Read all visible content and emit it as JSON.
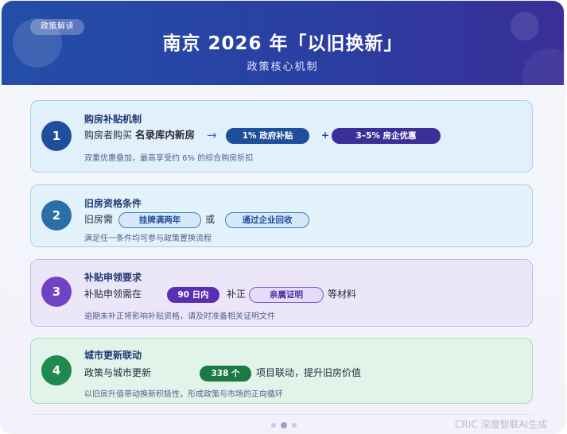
{
  "header": {
    "tag": "政策解读",
    "title": "南京 2026 年「以旧换新」",
    "subtitle": "政策核心机制"
  },
  "steps": [
    {
      "number": "1",
      "title": "购房补贴机制",
      "text1": "购房者购买",
      "text2": "名录库内新房",
      "arrow": "→",
      "pill1": "1% 政府补贴",
      "plus": "+",
      "pill2": "3–5% 房企优惠",
      "note": "双重优惠叠加，最高享受约 6% 的综合购房折扣"
    },
    {
      "number": "2",
      "title": "旧房资格条件",
      "text1": "旧房需",
      "pill1": "挂牌满两年",
      "text2": "或",
      "pill2": "通过企业回收",
      "note": "满足任一条件均可参与政策置换流程"
    },
    {
      "number": "3",
      "title": "补贴申领要求",
      "text1": "补贴申领需在",
      "pill1": "90 日内",
      "text2": "补正",
      "pill2": "亲属证明",
      "text3": "等材料",
      "note": "逾期未补正将影响补贴资格，请及时准备相关证明文件"
    },
    {
      "number": "4",
      "title": "城市更新联动",
      "text1": "政策与城市更新",
      "pill1": "338 个",
      "text2": "项目联动，提升旧房价值",
      "note": "以旧房升值带动换新积极性，形成政策与市场的正向循环"
    }
  ],
  "footer": {
    "watermark": "CRIC 深度智联AI生成"
  },
  "colors": {
    "header_start": "#234ea8",
    "header_end": "#3a2f98",
    "step1_accent": "#1f4f9a",
    "step2_accent": "#2a6fa8",
    "step3_accent": "#7043c6",
    "step4_accent": "#1e8a4e"
  }
}
